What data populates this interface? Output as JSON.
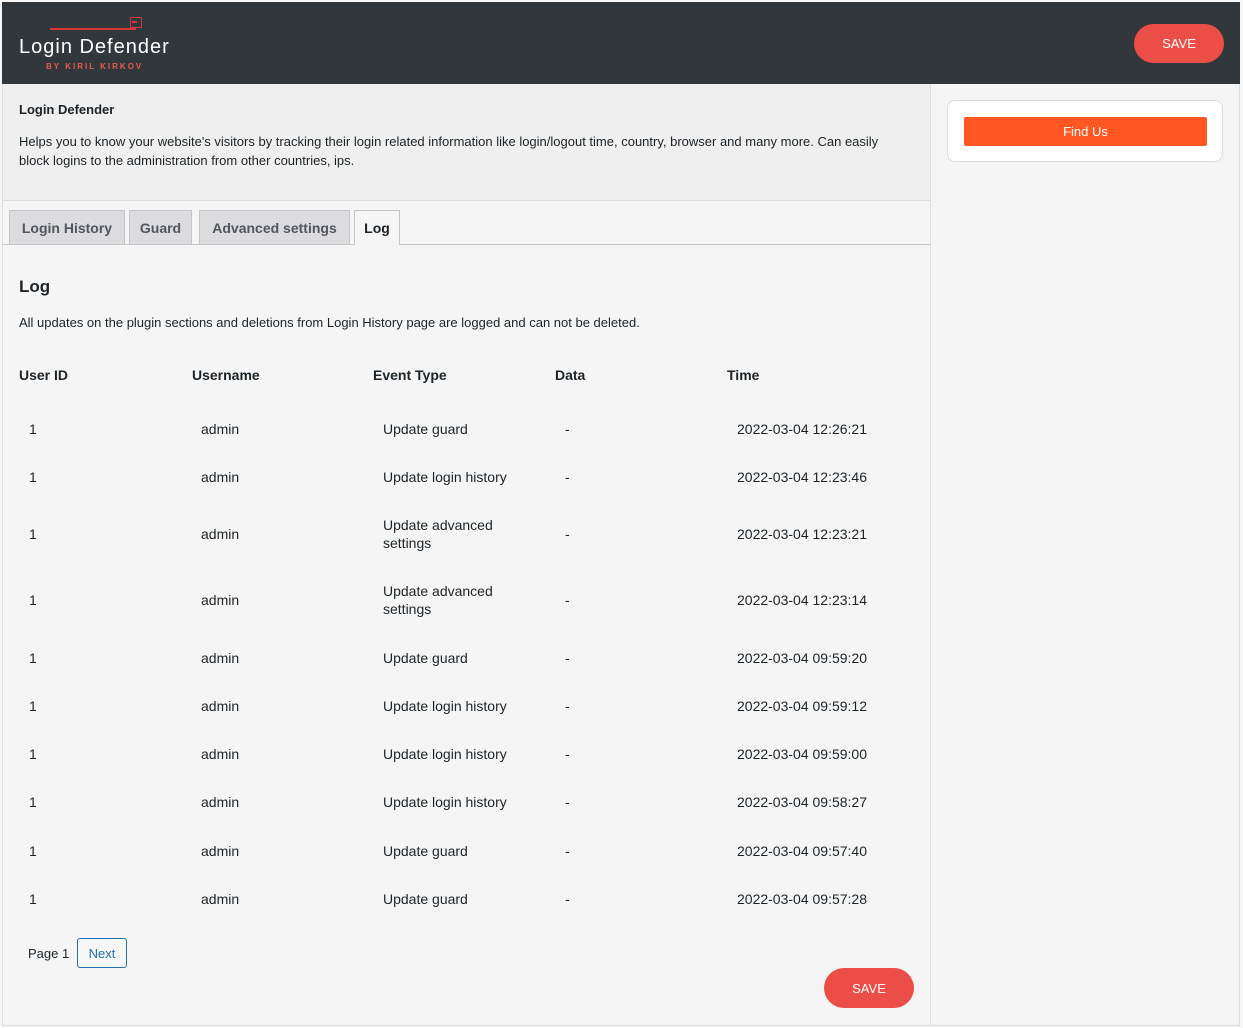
{
  "header": {
    "logo_title": "Login Defender",
    "logo_subtitle": "BY KIRIL KIRKOV",
    "save_label": "SAVE"
  },
  "intro": {
    "title": "Login Defender",
    "description": "Helps you to know your website's visitors by tracking their login related information like login/logout time, country, browser and many more. Can easily block logins to the administration from other countries, ips."
  },
  "tabs": [
    {
      "label": "Login History",
      "active": false
    },
    {
      "label": "Guard",
      "active": false
    },
    {
      "label": "Advanced settings",
      "active": false
    },
    {
      "label": "Log",
      "active": true
    }
  ],
  "log": {
    "title": "Log",
    "description": "All updates on the plugin sections and deletions from Login History page are logged and can not be deleted.",
    "columns": [
      "User ID",
      "Username",
      "Event Type",
      "Data",
      "Time"
    ],
    "rows": [
      {
        "user_id": "1",
        "username": "admin",
        "event": "Update guard",
        "data": "-",
        "time": "2022-03-04 12:26:21"
      },
      {
        "user_id": "1",
        "username": "admin",
        "event": "Update login history",
        "data": "-",
        "time": "2022-03-04 12:23:46"
      },
      {
        "user_id": "1",
        "username": "admin",
        "event": "Update advanced settings",
        "data": "-",
        "time": "2022-03-04 12:23:21"
      },
      {
        "user_id": "1",
        "username": "admin",
        "event": "Update advanced settings",
        "data": "-",
        "time": "2022-03-04 12:23:14"
      },
      {
        "user_id": "1",
        "username": "admin",
        "event": "Update guard",
        "data": "-",
        "time": "2022-03-04 09:59:20"
      },
      {
        "user_id": "1",
        "username": "admin",
        "event": "Update login history",
        "data": "-",
        "time": "2022-03-04 09:59:12"
      },
      {
        "user_id": "1",
        "username": "admin",
        "event": "Update login history",
        "data": "-",
        "time": "2022-03-04 09:59:00"
      },
      {
        "user_id": "1",
        "username": "admin",
        "event": "Update login history",
        "data": "-",
        "time": "2022-03-04 09:58:27"
      },
      {
        "user_id": "1",
        "username": "admin",
        "event": "Update guard",
        "data": "-",
        "time": "2022-03-04 09:57:40"
      },
      {
        "user_id": "1",
        "username": "admin",
        "event": "Update guard",
        "data": "-",
        "time": "2022-03-04 09:57:28"
      }
    ]
  },
  "pagination": {
    "page_label": "Page 1",
    "next_label": "Next"
  },
  "footer": {
    "save_label": "SAVE"
  },
  "sidebar": {
    "find_us_label": "Find Us"
  },
  "colors": {
    "header_bg": "#32373c",
    "save_button": "#ea4e47",
    "find_us_button": "#ff5722",
    "link": "#2271b1"
  }
}
